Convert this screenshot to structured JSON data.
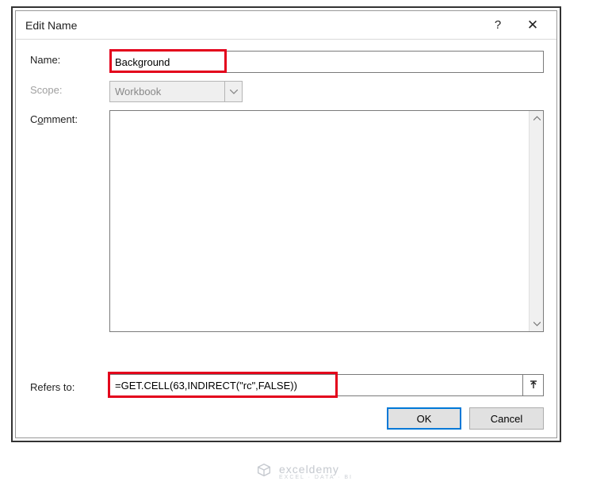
{
  "titlebar": {
    "title": "Edit Name",
    "help_label": "?",
    "close_label": "✕"
  },
  "labels": {
    "name": "Name:",
    "scope": "Scope:",
    "comment": "Comment:",
    "refers_to": "Refers to:"
  },
  "fields": {
    "name_value": "Background",
    "scope_value": "Workbook",
    "comment_value": "",
    "refers_to_value": "=GET.CELL(63,INDIRECT(\"rc\",FALSE))"
  },
  "buttons": {
    "ok": "OK",
    "cancel": "Cancel"
  },
  "watermark": {
    "brand": "exceldemy",
    "tagline": "EXCEL · DATA · BI"
  },
  "highlights": {
    "name_box_color": "#e3001b",
    "refers_box_color": "#e3001b"
  }
}
